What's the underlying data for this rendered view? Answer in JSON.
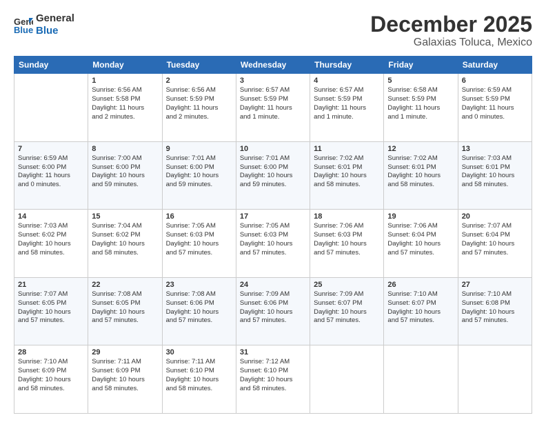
{
  "header": {
    "logo_line1": "General",
    "logo_line2": "Blue",
    "title": "December 2025",
    "subtitle": "Galaxias Toluca, Mexico"
  },
  "days_of_week": [
    "Sunday",
    "Monday",
    "Tuesday",
    "Wednesday",
    "Thursday",
    "Friday",
    "Saturday"
  ],
  "weeks": [
    [
      {
        "day": "",
        "content": ""
      },
      {
        "day": "1",
        "content": "Sunrise: 6:56 AM\nSunset: 5:58 PM\nDaylight: 11 hours\nand 2 minutes."
      },
      {
        "day": "2",
        "content": "Sunrise: 6:56 AM\nSunset: 5:59 PM\nDaylight: 11 hours\nand 2 minutes."
      },
      {
        "day": "3",
        "content": "Sunrise: 6:57 AM\nSunset: 5:59 PM\nDaylight: 11 hours\nand 1 minute."
      },
      {
        "day": "4",
        "content": "Sunrise: 6:57 AM\nSunset: 5:59 PM\nDaylight: 11 hours\nand 1 minute."
      },
      {
        "day": "5",
        "content": "Sunrise: 6:58 AM\nSunset: 5:59 PM\nDaylight: 11 hours\nand 1 minute."
      },
      {
        "day": "6",
        "content": "Sunrise: 6:59 AM\nSunset: 5:59 PM\nDaylight: 11 hours\nand 0 minutes."
      }
    ],
    [
      {
        "day": "7",
        "content": "Sunrise: 6:59 AM\nSunset: 6:00 PM\nDaylight: 11 hours\nand 0 minutes."
      },
      {
        "day": "8",
        "content": "Sunrise: 7:00 AM\nSunset: 6:00 PM\nDaylight: 10 hours\nand 59 minutes."
      },
      {
        "day": "9",
        "content": "Sunrise: 7:01 AM\nSunset: 6:00 PM\nDaylight: 10 hours\nand 59 minutes."
      },
      {
        "day": "10",
        "content": "Sunrise: 7:01 AM\nSunset: 6:00 PM\nDaylight: 10 hours\nand 59 minutes."
      },
      {
        "day": "11",
        "content": "Sunrise: 7:02 AM\nSunset: 6:01 PM\nDaylight: 10 hours\nand 58 minutes."
      },
      {
        "day": "12",
        "content": "Sunrise: 7:02 AM\nSunset: 6:01 PM\nDaylight: 10 hours\nand 58 minutes."
      },
      {
        "day": "13",
        "content": "Sunrise: 7:03 AM\nSunset: 6:01 PM\nDaylight: 10 hours\nand 58 minutes."
      }
    ],
    [
      {
        "day": "14",
        "content": "Sunrise: 7:03 AM\nSunset: 6:02 PM\nDaylight: 10 hours\nand 58 minutes."
      },
      {
        "day": "15",
        "content": "Sunrise: 7:04 AM\nSunset: 6:02 PM\nDaylight: 10 hours\nand 58 minutes."
      },
      {
        "day": "16",
        "content": "Sunrise: 7:05 AM\nSunset: 6:03 PM\nDaylight: 10 hours\nand 57 minutes."
      },
      {
        "day": "17",
        "content": "Sunrise: 7:05 AM\nSunset: 6:03 PM\nDaylight: 10 hours\nand 57 minutes."
      },
      {
        "day": "18",
        "content": "Sunrise: 7:06 AM\nSunset: 6:03 PM\nDaylight: 10 hours\nand 57 minutes."
      },
      {
        "day": "19",
        "content": "Sunrise: 7:06 AM\nSunset: 6:04 PM\nDaylight: 10 hours\nand 57 minutes."
      },
      {
        "day": "20",
        "content": "Sunrise: 7:07 AM\nSunset: 6:04 PM\nDaylight: 10 hours\nand 57 minutes."
      }
    ],
    [
      {
        "day": "21",
        "content": "Sunrise: 7:07 AM\nSunset: 6:05 PM\nDaylight: 10 hours\nand 57 minutes."
      },
      {
        "day": "22",
        "content": "Sunrise: 7:08 AM\nSunset: 6:05 PM\nDaylight: 10 hours\nand 57 minutes."
      },
      {
        "day": "23",
        "content": "Sunrise: 7:08 AM\nSunset: 6:06 PM\nDaylight: 10 hours\nand 57 minutes."
      },
      {
        "day": "24",
        "content": "Sunrise: 7:09 AM\nSunset: 6:06 PM\nDaylight: 10 hours\nand 57 minutes."
      },
      {
        "day": "25",
        "content": "Sunrise: 7:09 AM\nSunset: 6:07 PM\nDaylight: 10 hours\nand 57 minutes."
      },
      {
        "day": "26",
        "content": "Sunrise: 7:10 AM\nSunset: 6:07 PM\nDaylight: 10 hours\nand 57 minutes."
      },
      {
        "day": "27",
        "content": "Sunrise: 7:10 AM\nSunset: 6:08 PM\nDaylight: 10 hours\nand 57 minutes."
      }
    ],
    [
      {
        "day": "28",
        "content": "Sunrise: 7:10 AM\nSunset: 6:09 PM\nDaylight: 10 hours\nand 58 minutes."
      },
      {
        "day": "29",
        "content": "Sunrise: 7:11 AM\nSunset: 6:09 PM\nDaylight: 10 hours\nand 58 minutes."
      },
      {
        "day": "30",
        "content": "Sunrise: 7:11 AM\nSunset: 6:10 PM\nDaylight: 10 hours\nand 58 minutes."
      },
      {
        "day": "31",
        "content": "Sunrise: 7:12 AM\nSunset: 6:10 PM\nDaylight: 10 hours\nand 58 minutes."
      },
      {
        "day": "",
        "content": ""
      },
      {
        "day": "",
        "content": ""
      },
      {
        "day": "",
        "content": ""
      }
    ]
  ]
}
